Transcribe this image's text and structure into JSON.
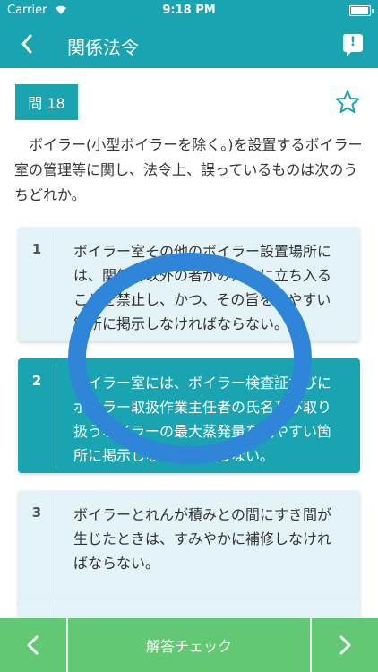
{
  "status": {
    "carrier": "Carrier",
    "time": "9:18 PM"
  },
  "nav": {
    "title": "関係法令",
    "report_label": "!"
  },
  "question": {
    "number_label": "問 18",
    "text": "ボイラー(小型ボイラーを除く。)を設置するボイラー室の管理等に関し、法令上、誤っているものは次のうちどれか。"
  },
  "choices": [
    {
      "num": "1",
      "text": "ボイラー室その他のボイラー設置場所には、関係者以外の者がみだりに立ち入ることを禁止し、かつ、その旨を見やすい箇所に掲示しなければならない。"
    },
    {
      "num": "2",
      "text": "ボイラー室には、ボイラー検査証並びにボイラー取扱作業主任者の氏名及び取り扱うボイラーの最大蒸発量を見やすい箇所に掲示しなければならない。"
    },
    {
      "num": "3",
      "text": "ボイラーとれんが積みとの間にすき間が生じたときは、すみやかに補修しなければならない。"
    }
  ],
  "bottom": {
    "check_label": "解答チェック"
  },
  "colors": {
    "accent": "#1aa3b0",
    "bottom_bar": "#63c873",
    "ring": "#2f86d8"
  },
  "icons": {
    "back": "chevron-left-icon",
    "report": "report-icon",
    "favorite": "star-outline-icon"
  }
}
